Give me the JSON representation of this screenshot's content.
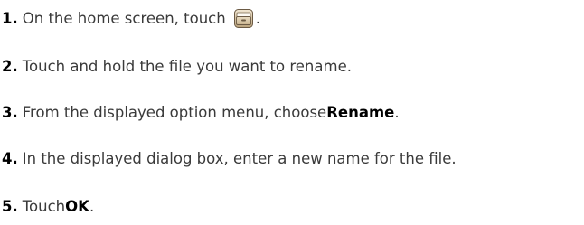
{
  "steps": [
    {
      "number": "1",
      "text_before": "On the home screen, touch ",
      "icon": "file-manager-icon",
      "text_after": "."
    },
    {
      "number": "2",
      "text": "Touch and hold the file you want to rename."
    },
    {
      "number": "3",
      "text_before": "From the displayed option menu, choose ",
      "bold": "Rename",
      "text_after": "."
    },
    {
      "number": "4",
      "text": "In the displayed dialog box, enter a new name for the file."
    },
    {
      "number": "5",
      "text_before": "Touch ",
      "bold": "OK",
      "text_after": "."
    }
  ],
  "colors": {
    "text": "#3a3a3a",
    "number": "#000000",
    "icon_frame": "#6b5a44",
    "icon_body": "#d8c7a8"
  }
}
